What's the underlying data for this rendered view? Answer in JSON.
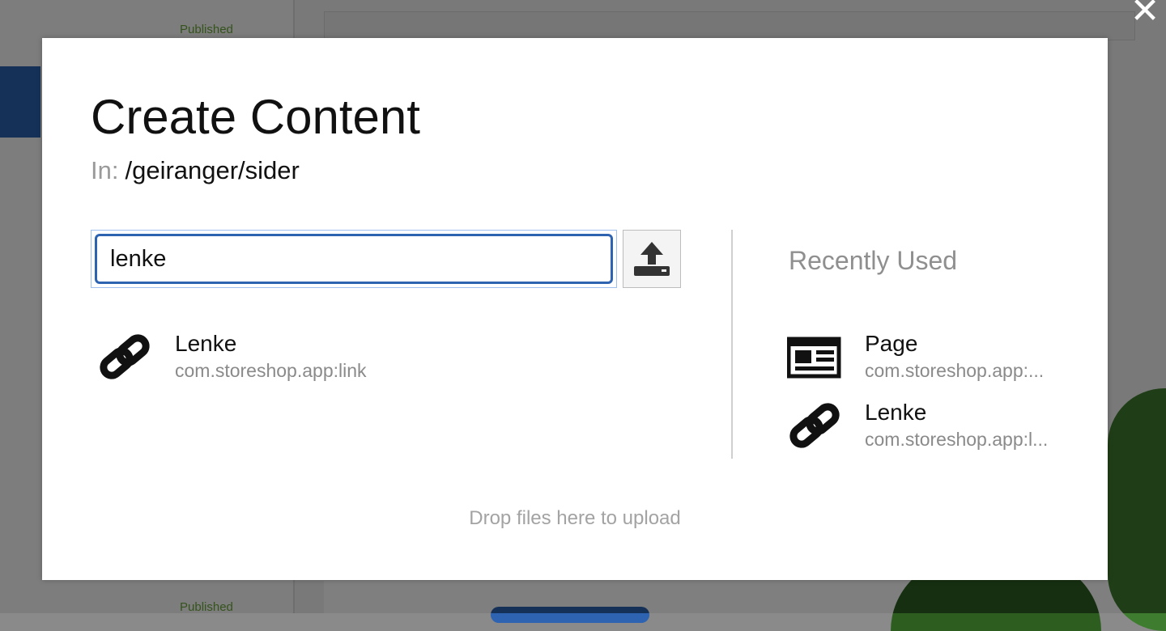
{
  "background": {
    "status_label": "Published"
  },
  "modal": {
    "close_symbol": "✕"
  },
  "dialog": {
    "title": "Create Content",
    "path_label": "In:",
    "path_value": "/geiranger/sider",
    "search": {
      "value": "lenke"
    },
    "upload_icon": "upload-icon",
    "results": [
      {
        "name": "Lenke",
        "type": "com.storeshop.app:link",
        "icon": "link-icon"
      }
    ],
    "recently_used": {
      "title": "Recently Used",
      "items": [
        {
          "name": "Page",
          "type": "com.storeshop.app:...",
          "icon": "page-icon"
        },
        {
          "name": "Lenke",
          "type": "com.storeshop.app:l...",
          "icon": "link-icon"
        }
      ]
    },
    "drop_hint": "Drop files here to upload"
  },
  "colors": {
    "accent": "#2d63b0",
    "status_green": "#6aa73a",
    "muted_text": "#8a8a8a"
  }
}
